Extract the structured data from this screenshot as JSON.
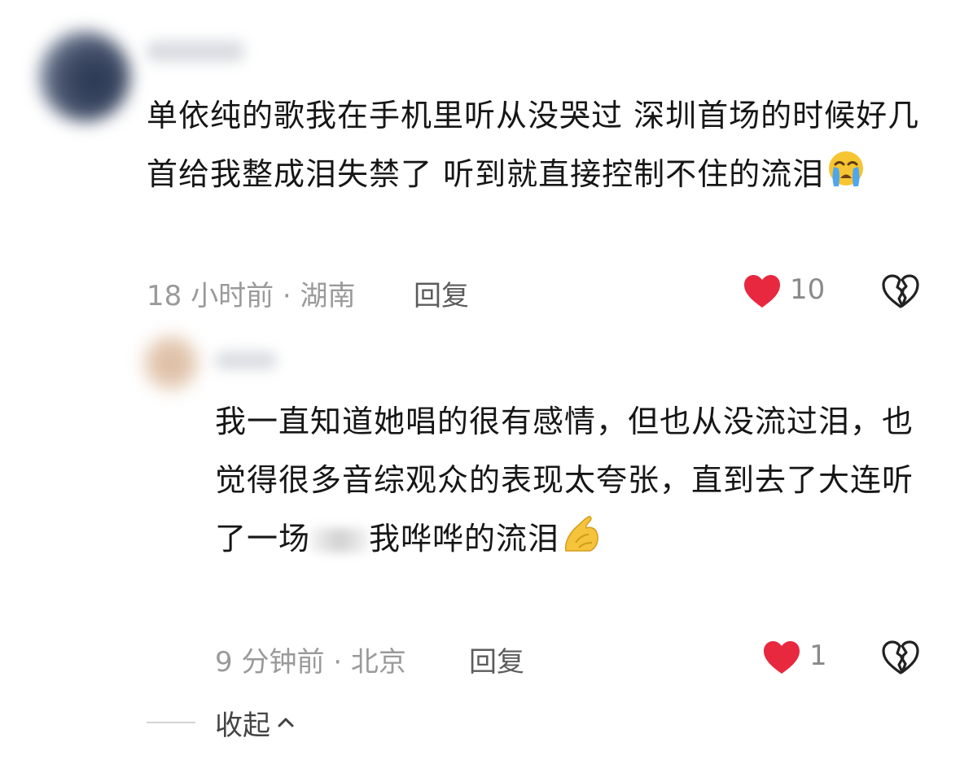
{
  "comment": {
    "text_before_emoji": "单依纯的歌我在手机里听从没哭过 深圳首场的时候好几首给我整成泪失禁了 听到就直接控制不住的流泪",
    "emoji": "loudly-crying-face",
    "meta": "18 小时前 · 湖南",
    "reply_label": "回复",
    "like_count": "10",
    "like_icon": "heart-icon",
    "dislike_icon": "broken-heart-icon",
    "like_color": "#e8283f"
  },
  "reply": {
    "text_part1": "我一直知道她唱的很有感情，但也从没流过泪，也觉得很多音综观众的表现太夸张，直到去了大连听了一场",
    "text_part2": "我哗哗的流泪",
    "emoji": "pinched-fingers",
    "meta": "9 分钟前 · 北京",
    "reply_label": "回复",
    "like_count": "1",
    "like_icon": "heart-icon",
    "dislike_icon": "broken-heart-icon"
  },
  "collapse_label": "收起"
}
